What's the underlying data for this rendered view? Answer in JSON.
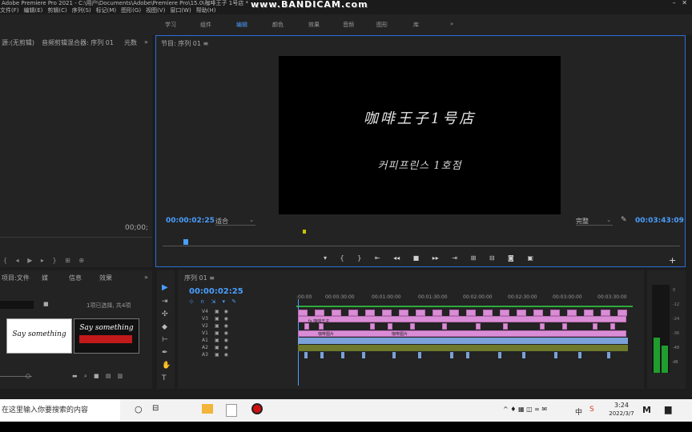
{
  "window": {
    "title": "Adobe Premiere Pro 2021 - C:\\用户\\Documents\\Adobe\\Premiere Pro\\15.0\\咖啡王子 1号店 *"
  },
  "menu": [
    "文件(F)",
    "编辑(E)",
    "剪辑(C)",
    "序列(S)",
    "标记(M)",
    "图形(G)",
    "视图(V)",
    "窗口(W)",
    "帮助(H)"
  ],
  "watermark": "www.BANDICAM.com",
  "workspaces": [
    {
      "label": "学习",
      "active": false
    },
    {
      "label": "组件",
      "active": false
    },
    {
      "label": "编辑",
      "active": true
    },
    {
      "label": "颜色",
      "active": false
    },
    {
      "label": "效果",
      "active": false
    },
    {
      "label": "音频",
      "active": false
    },
    {
      "label": "图形",
      "active": false
    },
    {
      "label": "库",
      "active": false
    },
    {
      "label": "»",
      "active": false
    }
  ],
  "source_panel": {
    "tabs": [
      "源:(无剪辑)",
      "音频剪辑混合器: 序列 01",
      "元数",
      "»"
    ],
    "timecode": "00;00;"
  },
  "program": {
    "header": "节目: 序列 01 ≡",
    "video_title": "咖啡王子1号店",
    "video_subtitle": "커피프린스 1호점",
    "timecode_current": "00:00:02:25",
    "fit": "适合",
    "quality": "完整",
    "timecode_duration": "00:03:43:09"
  },
  "project": {
    "tabs": [
      "项目:文件",
      "媒",
      "信息",
      "效果",
      "»"
    ],
    "count": "1项已选择, 共4项",
    "thumbs": [
      {
        "label": "Say something"
      },
      {
        "label": "Say something"
      }
    ]
  },
  "timeline": {
    "header": "序列 01 ≡",
    "timecode": "00:00:02:25",
    "ruler": [
      ":00:00",
      "00:00:30:00",
      "00:01:00:00",
      "00:01:30:00",
      "00:02:00:00",
      "00:02:30:00",
      "00:03:00:00",
      "00:03:30:00"
    ],
    "video_tracks": [
      "V4",
      "V3",
      "V2",
      "V1"
    ],
    "audio_tracks": [
      "A1",
      "A2",
      "A3"
    ],
    "clip_labels": [
      "fx 咖啡王子",
      "咖啡图片",
      "咖啡图片"
    ]
  },
  "meters": {
    "scale": [
      "0",
      "-12",
      "-24",
      "-36",
      "-48",
      "dB"
    ]
  },
  "taskbar": {
    "search_placeholder": "在这里输入你要搜索的内容",
    "time": "3:24",
    "date": "2022/3/7",
    "ime": "中"
  }
}
